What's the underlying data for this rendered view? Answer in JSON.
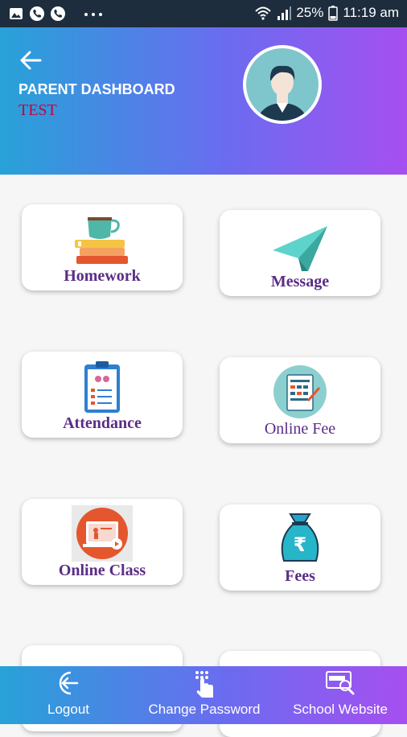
{
  "status_bar": {
    "battery": "25%",
    "time": "11:19 am"
  },
  "header": {
    "title": "PARENT DASHBOARD",
    "subtitle": "TEST"
  },
  "cards": [
    {
      "label": "Homework",
      "icon": "homework-icon"
    },
    {
      "label": "Message",
      "icon": "paper-plane-icon"
    },
    {
      "label": "Attendance",
      "icon": "clipboard-icon"
    },
    {
      "label": "Online Fee",
      "icon": "receipt-icon"
    },
    {
      "label": "Online Class",
      "icon": "online-class-icon"
    },
    {
      "label": "Fees",
      "icon": "money-bag-icon"
    }
  ],
  "bottom_nav": {
    "logout": "Logout",
    "change_password": "Change Password",
    "school_website": "School Website"
  },
  "colors": {
    "gradient_start": "#27a2d8",
    "gradient_end": "#a64ff0",
    "card_label": "#5a2d86",
    "subtitle": "#c9003c"
  }
}
